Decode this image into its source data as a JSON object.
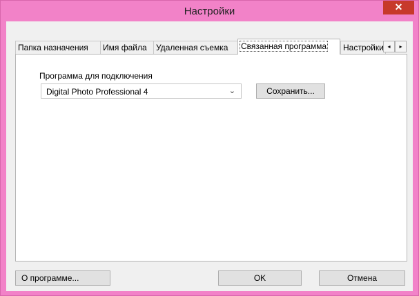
{
  "window": {
    "title": "Настройки",
    "close_glyph": "✕"
  },
  "tabs": [
    {
      "label": "Папка назначения",
      "active": false
    },
    {
      "label": "Имя файла",
      "active": false
    },
    {
      "label": "Удаленная съемка",
      "active": false
    },
    {
      "label": "Связанная программа",
      "active": true
    },
    {
      "label": "Настройки",
      "active": false
    }
  ],
  "tab_scroll": {
    "left_icon": "◂",
    "right_icon": "▸"
  },
  "linked_program": {
    "label": "Программа для подключения",
    "selected": "Digital Photo Professional 4",
    "save_label": "Сохранить..."
  },
  "footer": {
    "about_label": "О программе...",
    "ok_label": "OK",
    "cancel_label": "Отмена"
  },
  "colors": {
    "title_bar": "#f282c8",
    "close_button": "#c7392b"
  }
}
